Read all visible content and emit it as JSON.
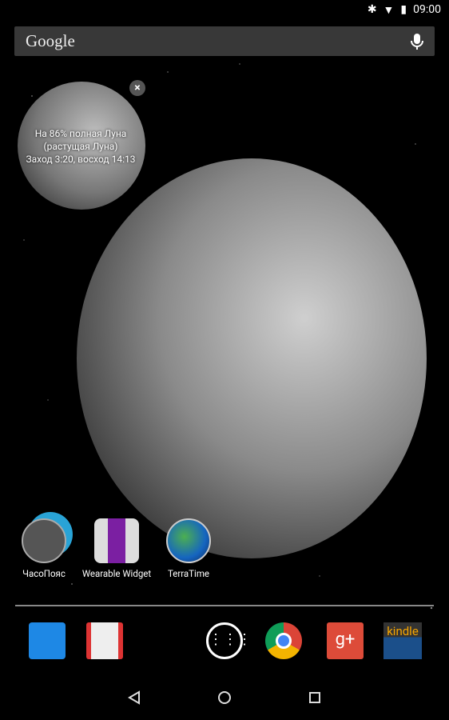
{
  "status": {
    "time": "09:00",
    "icons": [
      "bluetooth-icon",
      "wifi-icon",
      "battery-icon"
    ]
  },
  "search": {
    "logo": "Google",
    "icon": "mic-icon"
  },
  "moon_widget": {
    "lines": [
      "На 86% полная Луна",
      "(растущая Луна)",
      "Заход 3:20, восход 14:13"
    ],
    "close": "×"
  },
  "apps": [
    {
      "label": "ЧасоПояс"
    },
    {
      "label": "Wearable Widget"
    },
    {
      "label": "TerraTime"
    }
  ],
  "dock": [
    "contacts",
    "gmail",
    "app-drawer",
    "chrome",
    "google-plus",
    "kindle"
  ],
  "kindle_label": "kindle",
  "gplus_label": "g+",
  "colors": {
    "gplus": "#dd4b39",
    "contacts": "#1e88e5",
    "kindle": "#1b4f8a"
  }
}
